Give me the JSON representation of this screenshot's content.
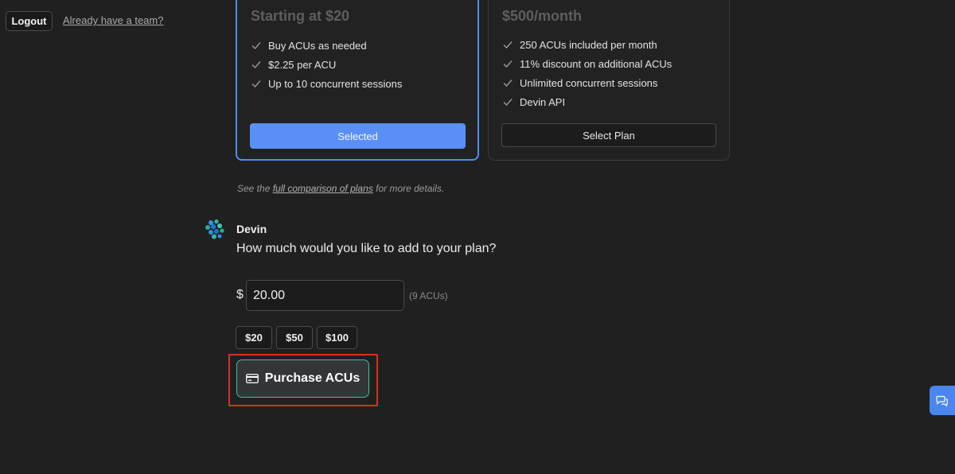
{
  "topbar": {
    "logout_label": "Logout",
    "team_link_label": "Already have a team?"
  },
  "plans": [
    {
      "price": "Starting at $20",
      "features": [
        "Buy ACUs as needed",
        "$2.25 per ACU",
        "Up to 10 concurrent sessions"
      ],
      "button_label": "Selected",
      "selected": true
    },
    {
      "price": "$500/month",
      "features": [
        "250 ACUs included per month",
        "11% discount on additional ACUs",
        "Unlimited concurrent sessions",
        "Devin API"
      ],
      "button_label": "Select Plan",
      "selected": false
    }
  ],
  "compare_note": {
    "prefix": "See the ",
    "link": "full comparison of plans",
    "suffix": " for more details."
  },
  "message": {
    "sender": "Devin",
    "question": "How much would you like to add to your plan?",
    "currency_symbol": "$",
    "amount_value": "20.00",
    "acu_note": "(9 ACUs)",
    "quick_amounts": [
      "$20",
      "$50",
      "$100"
    ],
    "purchase_label": "Purchase ACUs"
  },
  "colors": {
    "accent": "#4f8ef7",
    "highlight": "#d9301e",
    "purchase_border": "#3fbf9f"
  },
  "icons": {
    "check": "check-icon",
    "purchase": "credit-card-icon",
    "chat": "chat-icon",
    "logo": "devin-logo"
  }
}
